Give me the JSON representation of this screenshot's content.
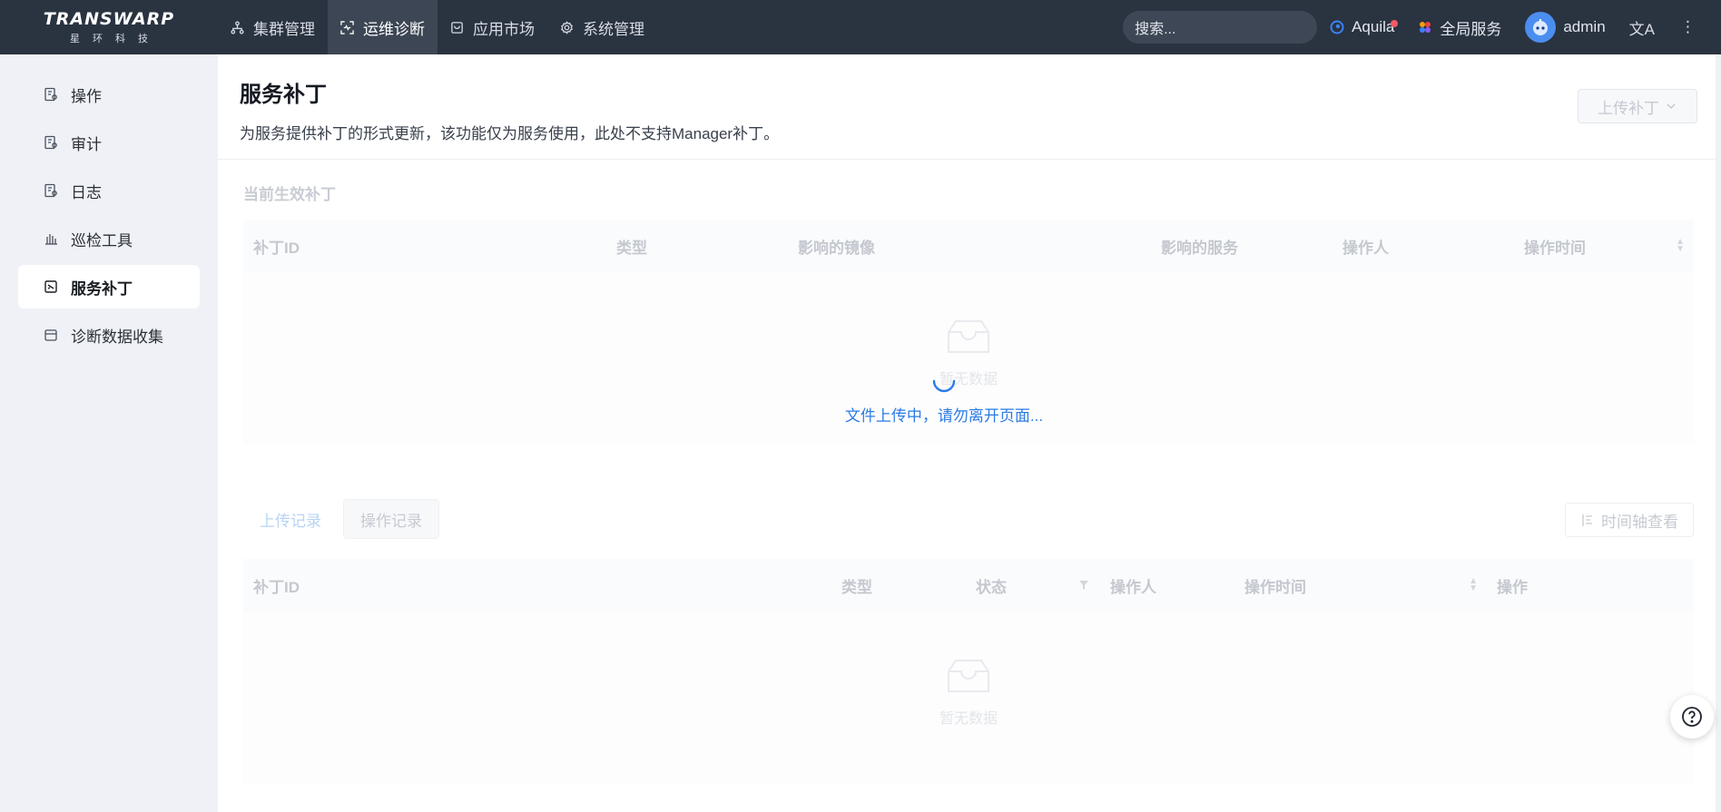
{
  "brand": {
    "logo_main": "TRANSWARP",
    "logo_sub": "星环科技"
  },
  "nav": [
    {
      "label": "集群管理",
      "icon": "cluster-icon"
    },
    {
      "label": "运维诊断",
      "icon": "diagnose-icon",
      "active": true
    },
    {
      "label": "应用市场",
      "icon": "market-icon"
    },
    {
      "label": "系统管理",
      "icon": "gear-icon"
    }
  ],
  "topbar": {
    "search_placeholder": "搜索...",
    "aquila": "Aquila",
    "all_services": "全局服务",
    "user": "admin",
    "lang_glyph": "文A"
  },
  "sidebar": [
    {
      "label": "操作",
      "icon": "operation-icon"
    },
    {
      "label": "审计",
      "icon": "audit-icon"
    },
    {
      "label": "日志",
      "icon": "log-icon"
    },
    {
      "label": "巡检工具",
      "icon": "inspection-icon"
    },
    {
      "label": "服务补丁",
      "icon": "patch-icon",
      "active": true
    },
    {
      "label": "诊断数据收集",
      "icon": "collect-icon"
    }
  ],
  "page": {
    "title": "服务补丁",
    "description": "为服务提供补丁的形式更新，该功能仅为服务使用，此处不支持Manager补丁。",
    "upload_button": "上传补丁"
  },
  "current_patches": {
    "section_title": "当前生效补丁",
    "columns": [
      "补丁ID",
      "类型",
      "影响的镜像",
      "影响的服务",
      "操作人",
      "操作时间"
    ],
    "empty_text": "暂无数据"
  },
  "loading": {
    "text": "文件上传中，请勿离开页面..."
  },
  "records": {
    "tabs": [
      "上传记录",
      "操作记录"
    ],
    "timeline_button": "时间轴查看",
    "columns": [
      "补丁ID",
      "类型",
      "状态",
      "操作人",
      "操作时间",
      "操作"
    ],
    "empty_text": "暂无数据"
  },
  "colors": {
    "topbar": "#2a3340",
    "accent": "#2b7be5",
    "sidebar_bg": "#eff1f6"
  }
}
